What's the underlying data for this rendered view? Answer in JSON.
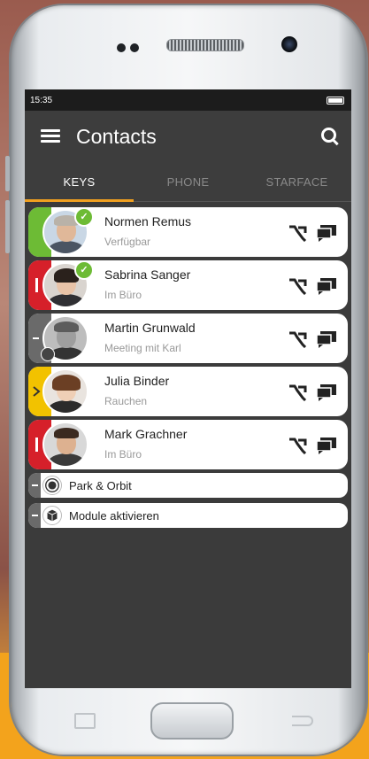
{
  "status_bar": {
    "time": "15:35"
  },
  "app_bar": {
    "title": "Contacts",
    "menu_icon": "menu-icon",
    "search_icon": "search-icon"
  },
  "tabs": [
    {
      "label": "KEYS",
      "active": true
    },
    {
      "label": "PHONE",
      "active": false
    },
    {
      "label": "STARFACE",
      "active": false
    }
  ],
  "contacts": [
    {
      "name": "Normen Remus",
      "status": "Verfügbar",
      "status_color": "#6dbb35",
      "available": true
    },
    {
      "name": "Sabrina Sanger",
      "status": "Im Büro",
      "status_color": "#d6202a",
      "available": true
    },
    {
      "name": "Martin Grunwald",
      "status": "Meeting mit Karl",
      "status_color": "#6a6a6a",
      "available": false
    },
    {
      "name": "Julia Binder",
      "status": "Rauchen",
      "status_color": "#f2c200",
      "available": false
    },
    {
      "name": "Mark Grachner",
      "status": "Im Büro",
      "status_color": "#d6202a",
      "available": false
    }
  ],
  "modules": [
    {
      "label": "Park & Orbit",
      "icon": "park-orbit-icon"
    },
    {
      "label": "Module aktivieren",
      "icon": "cube-icon"
    }
  ],
  "colors": {
    "accent": "#f0a020",
    "app_bg": "#3b3b3b",
    "available": "#6dbb35"
  }
}
